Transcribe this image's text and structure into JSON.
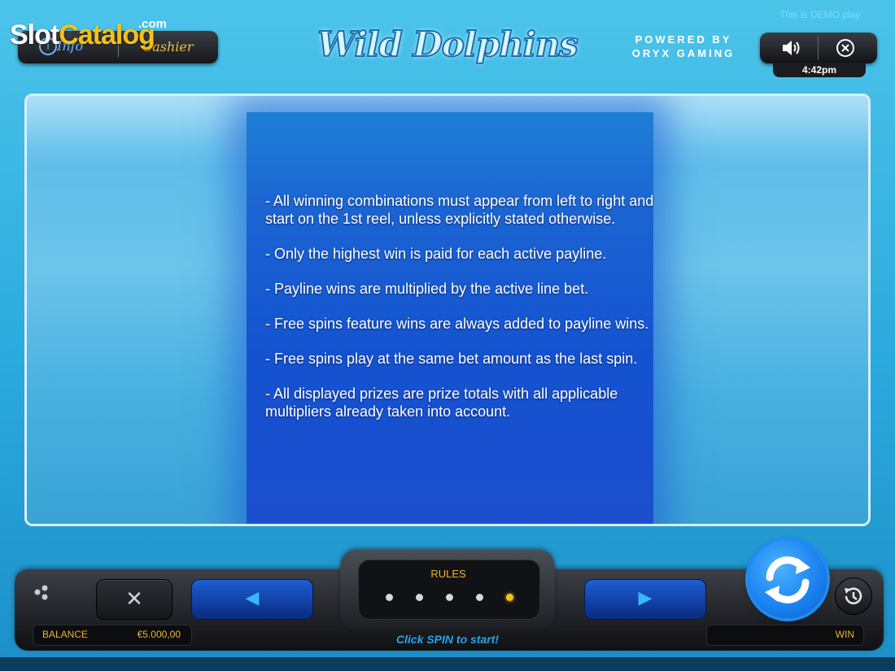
{
  "watermark": {
    "brand_slot": "Slot",
    "brand_catalog": "Catalog",
    "brand_com": ".com"
  },
  "top_left": {
    "info_label": "Info",
    "cashier_label": "Cashier"
  },
  "game": {
    "title": "Wild Dolphins",
    "powered_line1": "POWERED BY",
    "powered_line2": "ORYX GAMING"
  },
  "demo_notice": "This is DEMO play",
  "controls": {
    "clock": "4:42pm",
    "sound_icon": "speaker-icon",
    "close_icon": "close-icon"
  },
  "rules": {
    "paragraphs": [
      "- All winning combinations must appear from left to right and start on the 1st reel, unless explicitly stated otherwise.",
      "- Only the highest win is paid for each active payline.",
      "- Payline wins are multiplied by the active line bet.",
      "- Free spins feature wins are always added to payline wins.",
      "- Free spins play at the same bet amount as the last spin.",
      "- All displayed prizes are prize totals with all applicable multipliers already taken into account."
    ]
  },
  "bottom": {
    "rules_label": "RULES",
    "page_count": 5,
    "active_page": 5,
    "balance_label": "BALANCE",
    "balance_value": "€5.000,00",
    "win_label": "WIN",
    "status_message": "Click SPIN to start!"
  },
  "colors": {
    "accent_gold": "#f0b432",
    "spin_blue": "#1a7ff0",
    "active_dot": "#f5c21a"
  }
}
